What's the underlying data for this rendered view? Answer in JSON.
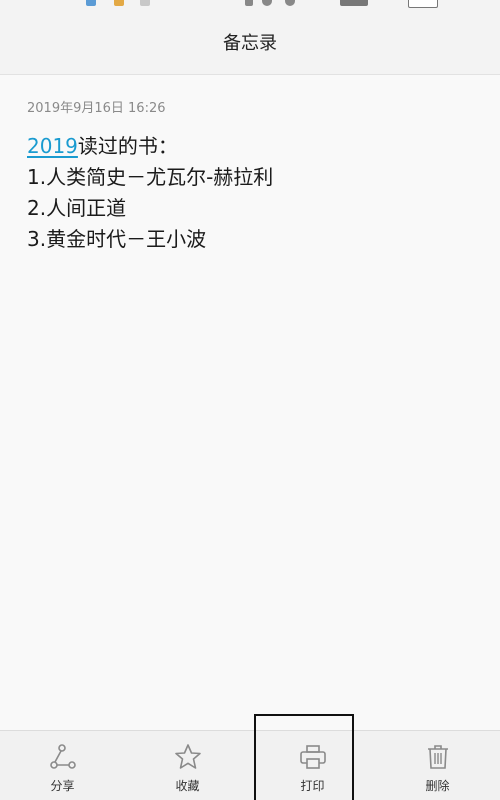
{
  "header": {
    "title": "备忘录"
  },
  "note": {
    "timestamp": "2019年9月16日 16:26",
    "title_link": "2019",
    "title_rest": "读过的书：",
    "lines": [
      "1.人类简史－尤瓦尔-赫拉利",
      "2.人间正道",
      "3.黄金时代－王小波"
    ]
  },
  "actions": [
    {
      "label": "分享",
      "icon": "share-icon"
    },
    {
      "label": "收藏",
      "icon": "star-icon"
    },
    {
      "label": "打印",
      "icon": "printer-icon"
    },
    {
      "label": "删除",
      "icon": "trash-icon"
    }
  ],
  "colors": {
    "link": "#1a9bd0",
    "icon": "#8a8a8a",
    "highlight": "#111111"
  }
}
